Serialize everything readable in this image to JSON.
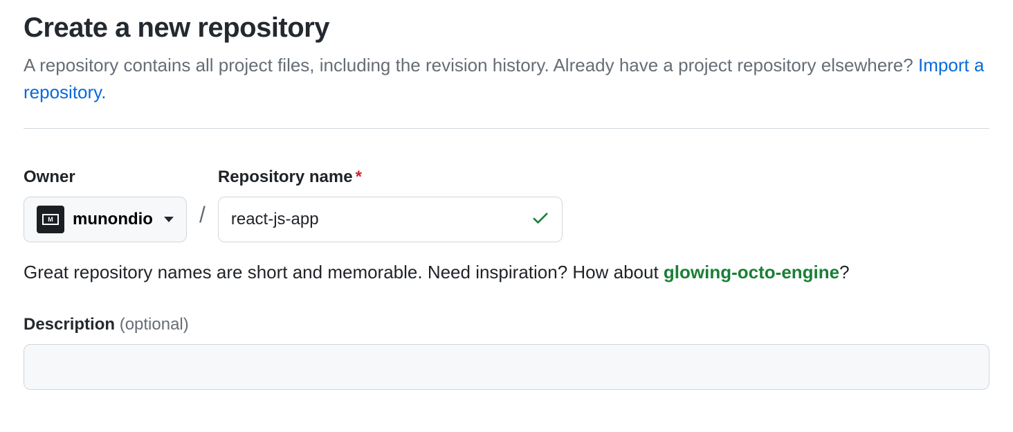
{
  "header": {
    "title": "Create a new repository",
    "subtitle_prefix": "A repository contains all project files, including the revision history. Already have a project repository elsewhere? ",
    "import_link": "Import a repository."
  },
  "form": {
    "owner": {
      "label": "Owner",
      "selected": "munondio"
    },
    "separator": "/",
    "repo_name": {
      "label": "Repository name",
      "value": "react-js-app"
    },
    "hint": {
      "prefix": "Great repository names are short and memorable. Need inspiration? How about ",
      "suggestion": "glowing-octo-engine",
      "suffix": "?"
    },
    "description": {
      "label": "Description ",
      "optional": "(optional)",
      "value": ""
    }
  }
}
